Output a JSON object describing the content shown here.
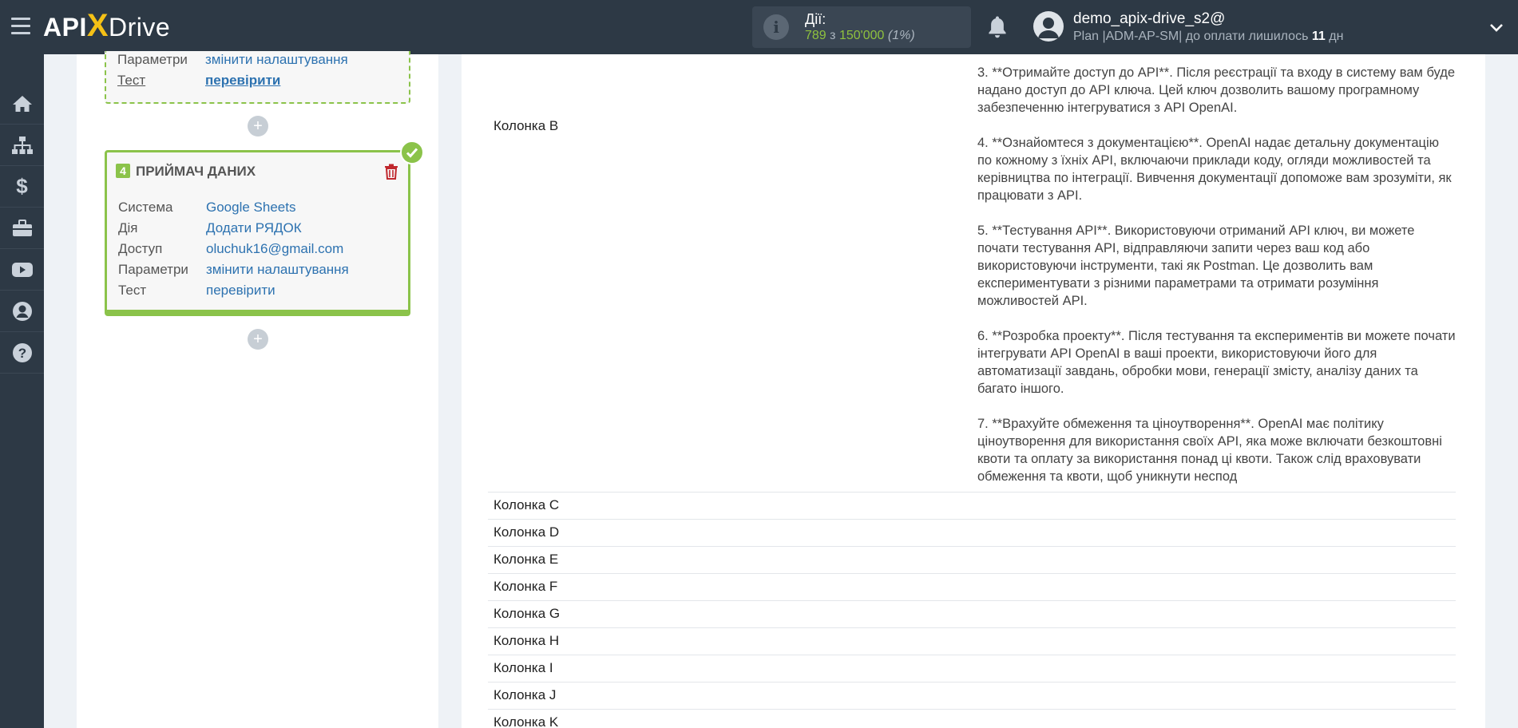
{
  "header": {
    "logo_api": "API",
    "logo_x": "X",
    "logo_drive": "Drive",
    "actions_label": "Дії:",
    "actions_used": "789",
    "actions_sep": "з",
    "actions_total": "150'000",
    "actions_pct": "(1%)",
    "user_name": "demo_apix-drive_s2@",
    "plan_text": "Plan |ADM-AP-SM| до оплати лишилось",
    "plan_days": "11",
    "plan_days_unit": "дн"
  },
  "left": {
    "prev_card": {
      "rows": [
        {
          "key": "Параметри",
          "value": "змінити налаштування"
        },
        {
          "key": "Тест",
          "value": "перевірити"
        }
      ]
    },
    "receiver": {
      "number": "4",
      "title": "ПРИЙМАЧ ДАНИХ",
      "rows": [
        {
          "key": "Система",
          "value": "Google Sheets"
        },
        {
          "key": "Дія",
          "value": "Додати РЯДОК"
        },
        {
          "key": "Доступ",
          "value": "oluchuk16@gmail.com"
        },
        {
          "key": "Параметри",
          "value": "змінити налаштування"
        },
        {
          "key": "Тест",
          "value": "перевірити"
        }
      ]
    }
  },
  "right": {
    "colB_label": "Колонка B",
    "colB_paragraphs": [
      "3. **Отримайте доступ до API**. Після реєстрації та входу в систему вам буде надано доступ до API ключа. Цей ключ дозволить вашому програмному забезпеченню інтегруватися з API OpenAI.",
      "4. **Ознайомтеся з документацією**. OpenAI надає детальну документацію по кожному з їхніх API, включаючи приклади коду, огляди можливостей та керівництва по інтеграції. Вивчення документації допоможе вам зрозуміти, як працювати з API.",
      "5. **Тестування API**. Використовуючи отриманий API ключ, ви можете почати тестування API, відправляючи запити через ваш код або використовуючи інструменти, такі як Postman. Це дозволить вам експериментувати з різними параметрами та отримати розуміння можливостей API.",
      "6. **Розробка проекту**. Після тестування та експериментів ви можете почати інтегрувати API OpenAI в ваші проекти, використовуючи його для автоматизації завдань, обробки мови, генерації змісту, аналізу даних та багато іншого.",
      "7. **Врахуйте обмеження та ціноутворення**. OpenAI має політику ціноутворення для використання своїх API, яка може включати безкоштовні квоти та оплату за використання понад ці квоти. Також слід враховувати обмеження та квоти, щоб уникнути неспод"
    ],
    "columns": [
      "Колонка C",
      "Колонка D",
      "Колонка E",
      "Колонка F",
      "Колонка G",
      "Колонка H",
      "Колонка I",
      "Колонка J",
      "Колонка K"
    ]
  },
  "colors": {
    "topbar": "#2d3945",
    "accent_green": "#8bc34a",
    "link_blue": "#2d72b0",
    "logo_yellow": "#f5c116"
  },
  "icons": {
    "sidebar": [
      "home-icon",
      "sitemap-icon",
      "dollar-icon",
      "briefcase-icon",
      "youtube-icon",
      "user-circle-icon",
      "help-icon"
    ]
  }
}
